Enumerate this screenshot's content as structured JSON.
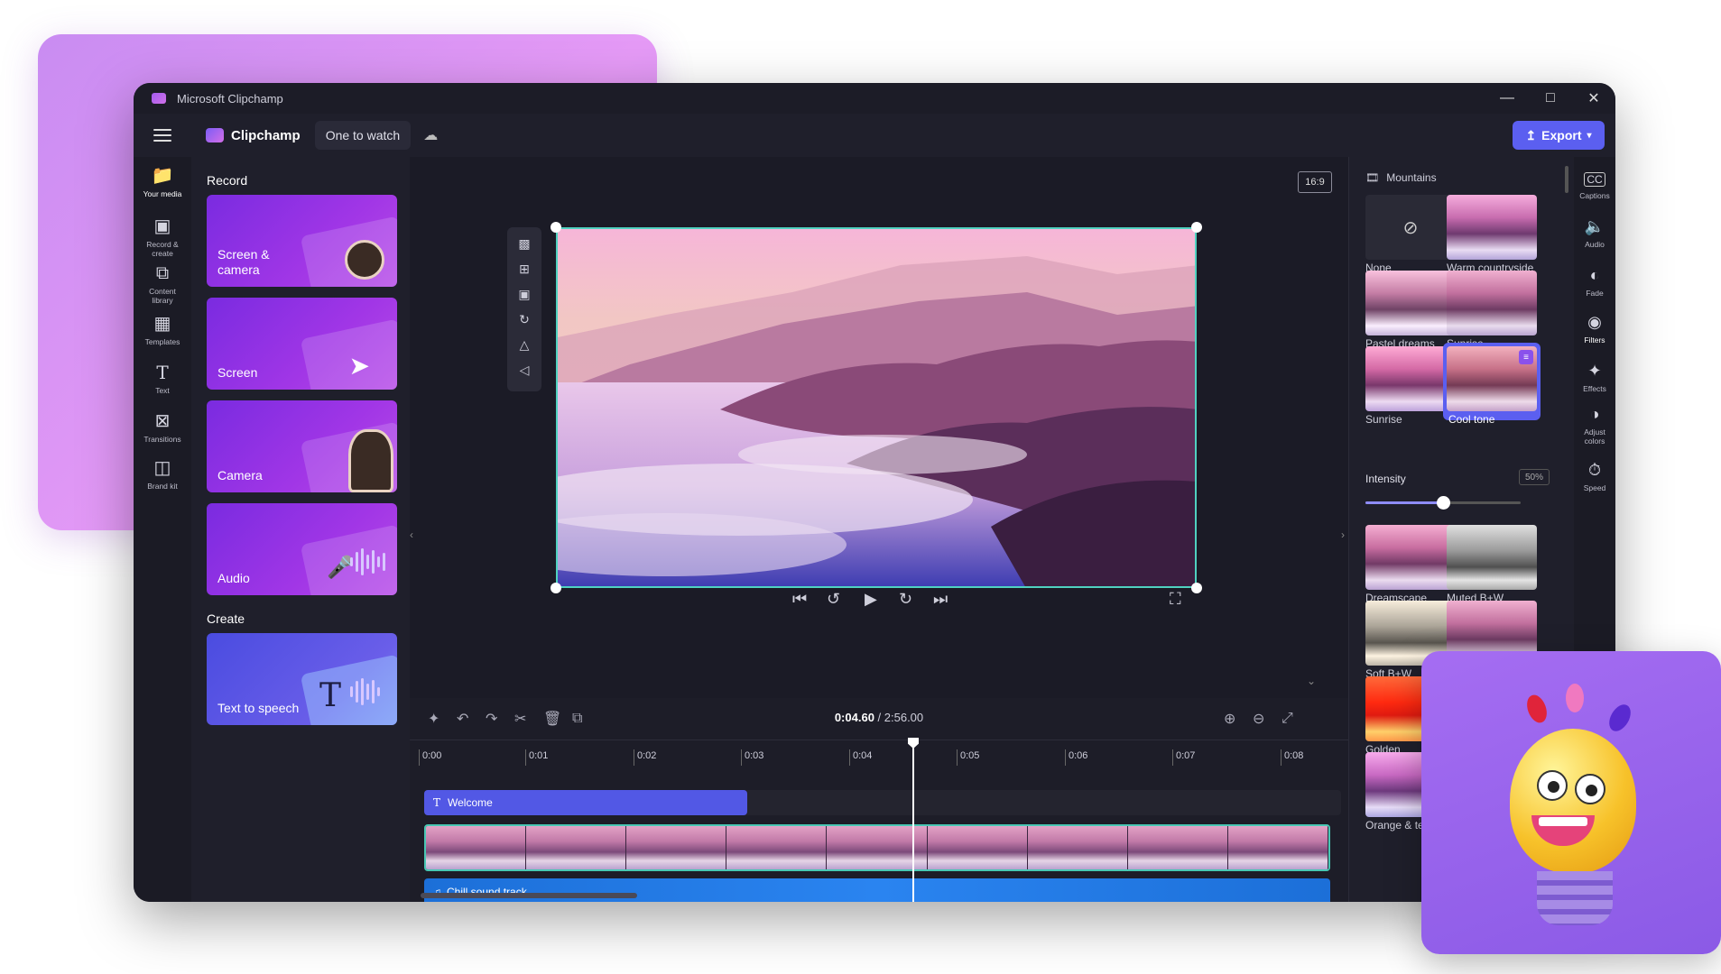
{
  "window": {
    "title": "Microsoft Clipchamp"
  },
  "header": {
    "brand": "Clipchamp",
    "project_name": "One to watch",
    "export_label": "Export"
  },
  "left_nav": [
    {
      "label": "Your media",
      "icon": "folder-icon"
    },
    {
      "label": "Record & create",
      "icon": "camera-icon"
    },
    {
      "label": "Content library",
      "icon": "library-icon"
    },
    {
      "label": "Templates",
      "icon": "templates-icon"
    },
    {
      "label": "Text",
      "icon": "text-icon"
    },
    {
      "label": "Transitions",
      "icon": "transitions-icon"
    },
    {
      "label": "Brand kit",
      "icon": "brand-icon"
    }
  ],
  "media_panel": {
    "record_heading": "Record",
    "record_tiles": [
      "Screen & camera",
      "Screen",
      "Camera",
      "Audio"
    ],
    "create_heading": "Create",
    "create_tiles": [
      "Text to speech"
    ]
  },
  "canvas": {
    "aspect_ratio": "16:9"
  },
  "timeline": {
    "current_time": "0:04.60",
    "total_time": "/ 2:56.00",
    "ticks": [
      "0:00",
      "0:01",
      "0:02",
      "0:03",
      "0:04",
      "0:05",
      "0:06",
      "0:07",
      "0:08"
    ],
    "text_track": "Welcome",
    "audio_track": "Chill sound track"
  },
  "filters_panel": {
    "heading": "Mountains",
    "filters": [
      "None",
      "Warm countryside",
      "Pastel dreams",
      "Sunrise",
      "Sunrise",
      "Cool tone",
      "Dreamscape",
      "Muted B+W",
      "Soft B+W",
      "Golden",
      "Orange & te"
    ],
    "selected": "Cool tone",
    "intensity_label": "Intensity",
    "intensity_value": "50%",
    "intensity_fraction": 0.5
  },
  "right_nav": [
    {
      "label": "Captions",
      "icon": "captions-icon"
    },
    {
      "label": "Audio",
      "icon": "audio-icon"
    },
    {
      "label": "Fade",
      "icon": "fade-icon"
    },
    {
      "label": "Filters",
      "icon": "filters-icon"
    },
    {
      "label": "Effects",
      "icon": "effects-icon"
    },
    {
      "label": "Adjust colors",
      "icon": "adjust-colors-icon"
    },
    {
      "label": "Speed",
      "icon": "speed-icon"
    }
  ],
  "colors": {
    "accent": "#5b5ff0",
    "selection": "#4fd2c0",
    "audio_track": "#2a84f0"
  }
}
